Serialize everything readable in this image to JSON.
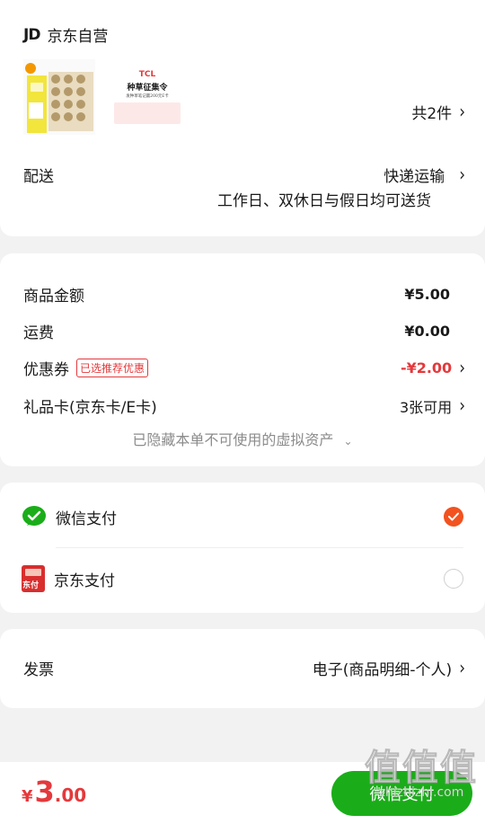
{
  "shop": {
    "logo": "JD",
    "name": "京东自营"
  },
  "goods": {
    "item2": {
      "brand": "TCL",
      "title": "种草征集令",
      "subtitle": "发种草笔记赢200元E卡"
    },
    "count_label": "共2件"
  },
  "delivery": {
    "label": "配送",
    "method": "快递运输",
    "note": "工作日、双休日与假日均可送货"
  },
  "summary": {
    "amount_label": "商品金额",
    "amount_value": "¥5.00",
    "freight_label": "运费",
    "freight_value": "¥0.00",
    "coupon_label": "优惠券",
    "coupon_tag": "已选推荐优惠",
    "coupon_value": "-¥2.00",
    "giftcard_label": "礼品卡(京东卡/E卡)",
    "giftcard_value": "3张可用",
    "hidden_note": "已隐藏本单不可使用的虚拟资产"
  },
  "payment": {
    "wechat_label": "微信支付",
    "wechat_selected": true,
    "jd_label": "京东支付",
    "jd_icon_text": "东付",
    "jd_selected": false
  },
  "invoice": {
    "label": "发票",
    "value": "电子(商品明细-个人)"
  },
  "footer": {
    "currency": "¥",
    "total_int": "3",
    "total_dec": ".00",
    "pay_button": "微信支付"
  },
  "watermark": {
    "big": "值值值",
    "site": "zhizhizhi.com"
  },
  "colors": {
    "accent": "#e4393c",
    "wechat": "#1aad19",
    "checked": "#f2521f"
  }
}
